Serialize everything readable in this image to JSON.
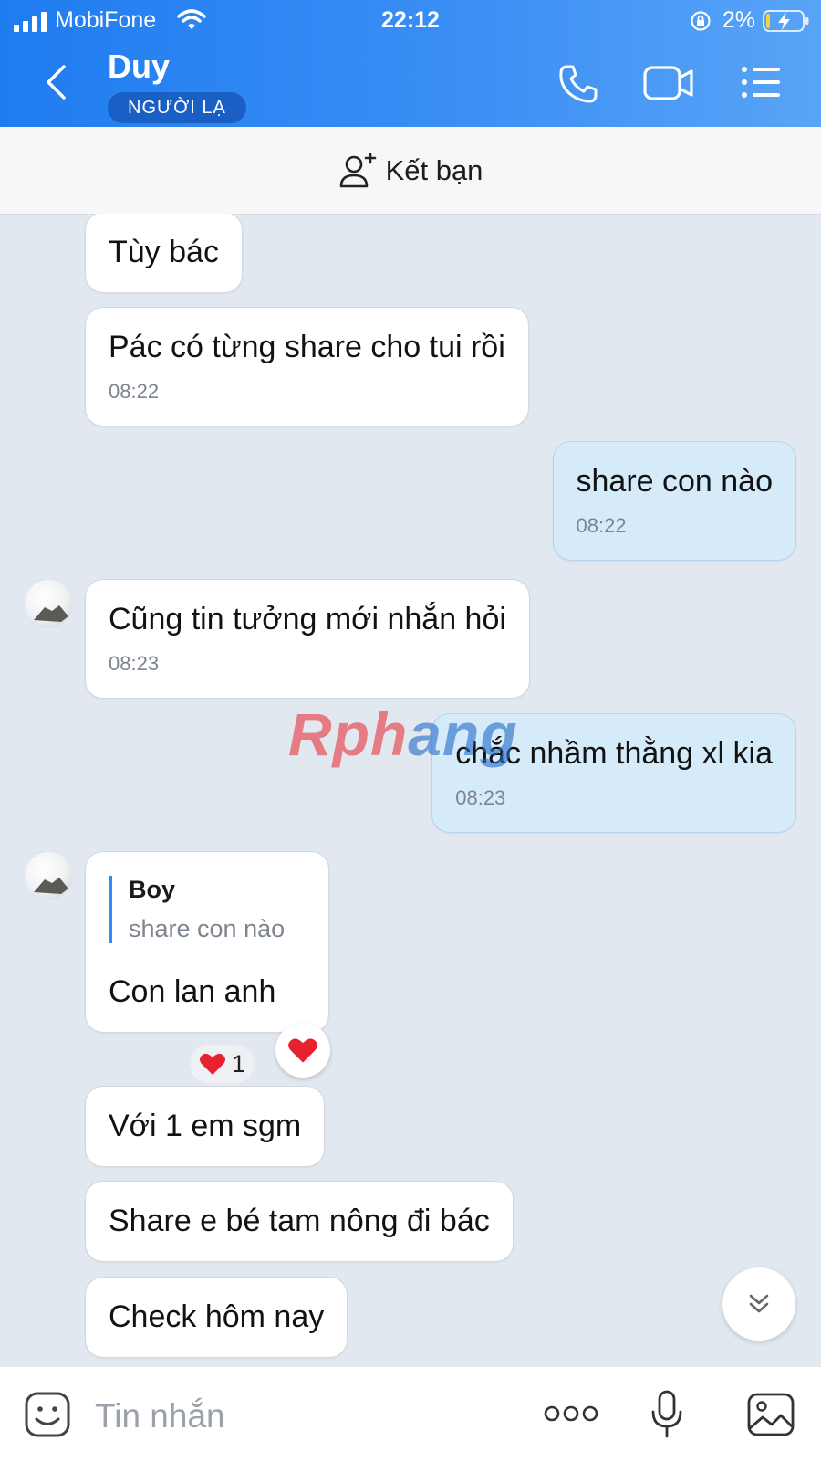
{
  "status_bar": {
    "carrier": "MobiFone",
    "time": "22:12",
    "battery": "2%"
  },
  "header": {
    "title": "Duy",
    "badge": "NGƯỜI LẠ"
  },
  "friend_bar": {
    "label": "Kết bạn"
  },
  "messages": [
    {
      "text": "Tùy bác"
    },
    {
      "text": "Pác có từng share cho tui rồi",
      "time": "08:22"
    },
    {
      "text": "share con nào",
      "time": "08:22"
    },
    {
      "text": "Cũng tin tưởng mới nhắn hỏi",
      "time": "08:23"
    },
    {
      "text": "chắc nhầm thằng xl kia",
      "time": "08:23"
    },
    {
      "quote_author": "Boy",
      "quote_text": "share con nào",
      "text": "Con lan anh",
      "reaction_count": "1"
    },
    {
      "text": "Với 1 em sgm"
    },
    {
      "text": "Share e bé tam nông đi bác"
    },
    {
      "text": "Check hôm nay"
    }
  ],
  "watermark": {
    "part1": "Rph",
    "part2": "ang"
  },
  "composer": {
    "placeholder": "Tin nhắn"
  },
  "colors": {
    "header_gradient_start": "#1f7cf0",
    "header_gradient_end": "#58a4f6",
    "incoming_bubble": "#ffffff",
    "outgoing_bubble": "#d6ebfa",
    "chat_background": "#e2e8f0"
  }
}
